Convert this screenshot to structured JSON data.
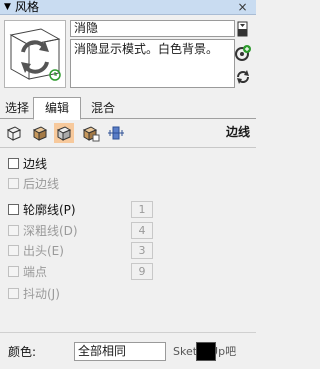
{
  "window": {
    "title": "风格",
    "close_glyph": "×"
  },
  "style": {
    "name": "消隐",
    "description": "消隐显示模式。白色背景。"
  },
  "tabs": [
    {
      "label": "选择",
      "active": false
    },
    {
      "label": "编辑",
      "active": true
    },
    {
      "label": "混合",
      "active": false
    }
  ],
  "toolbar": {
    "icons": [
      "edge-settings-icon",
      "face-settings-icon",
      "background-settings-icon",
      "watermark-settings-icon",
      "modeling-settings-icon"
    ],
    "active_icon": "background-settings-icon",
    "section_title": "边线"
  },
  "edges": {
    "edges_label": "边线",
    "edges_checked": false,
    "back_edges_label": "后边线",
    "profiles_label": "轮廓线(P)",
    "profiles_value": "1",
    "depth_cue_label": "深粗线(D)",
    "depth_cue_value": "4",
    "extension_label": "出头(E)",
    "extension_value": "3",
    "endpoints_label": "端点",
    "endpoints_value": "9",
    "jitter_label": "抖动(J)"
  },
  "color": {
    "label": "颜色:",
    "selected": "全部相同",
    "swatch": "#000000"
  },
  "watermark_text": "SketchUp吧",
  "colors": {
    "titlebar": "#c9dcf1",
    "active_tool_bg": "#f7c99c",
    "update_green": "#2e9b2e"
  }
}
